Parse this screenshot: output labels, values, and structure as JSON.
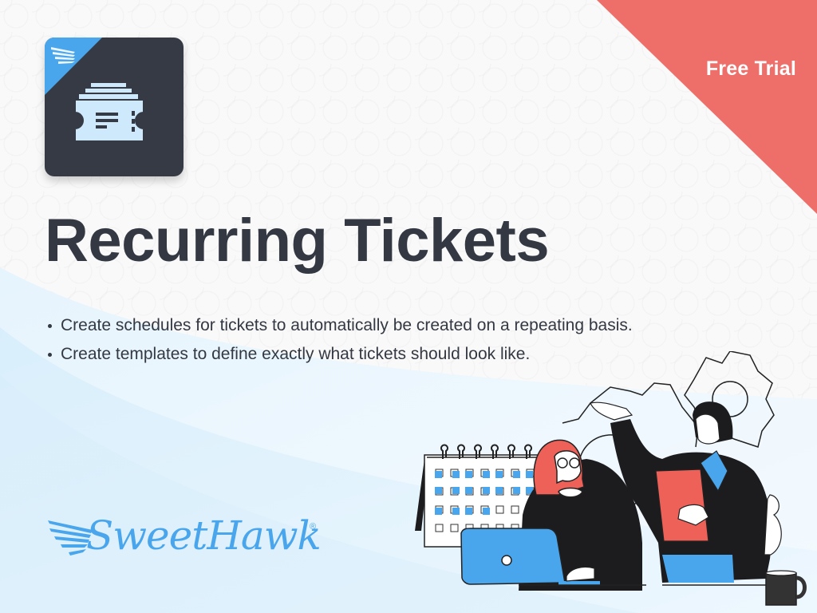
{
  "ribbon": {
    "label": "Free Trial",
    "color": "#ee6f6a"
  },
  "app_icon": {
    "name": "ticket-icon",
    "background": "#353a45",
    "accent": "#4aa6ec",
    "glyph_color": "#cde9fb"
  },
  "title": "Recurring Tickets",
  "bullets": [
    "Create schedules for tickets to automatically be created on a repeating basis.",
    "Create templates to define exactly what tickets should look like."
  ],
  "logo": {
    "text": "SweetHawk",
    "registered": "®",
    "color": "#4aa6ec"
  },
  "colors": {
    "text": "#333842",
    "blue": "#4aa6ec",
    "red": "#ee6f6a",
    "dark": "#1c1c1e"
  }
}
